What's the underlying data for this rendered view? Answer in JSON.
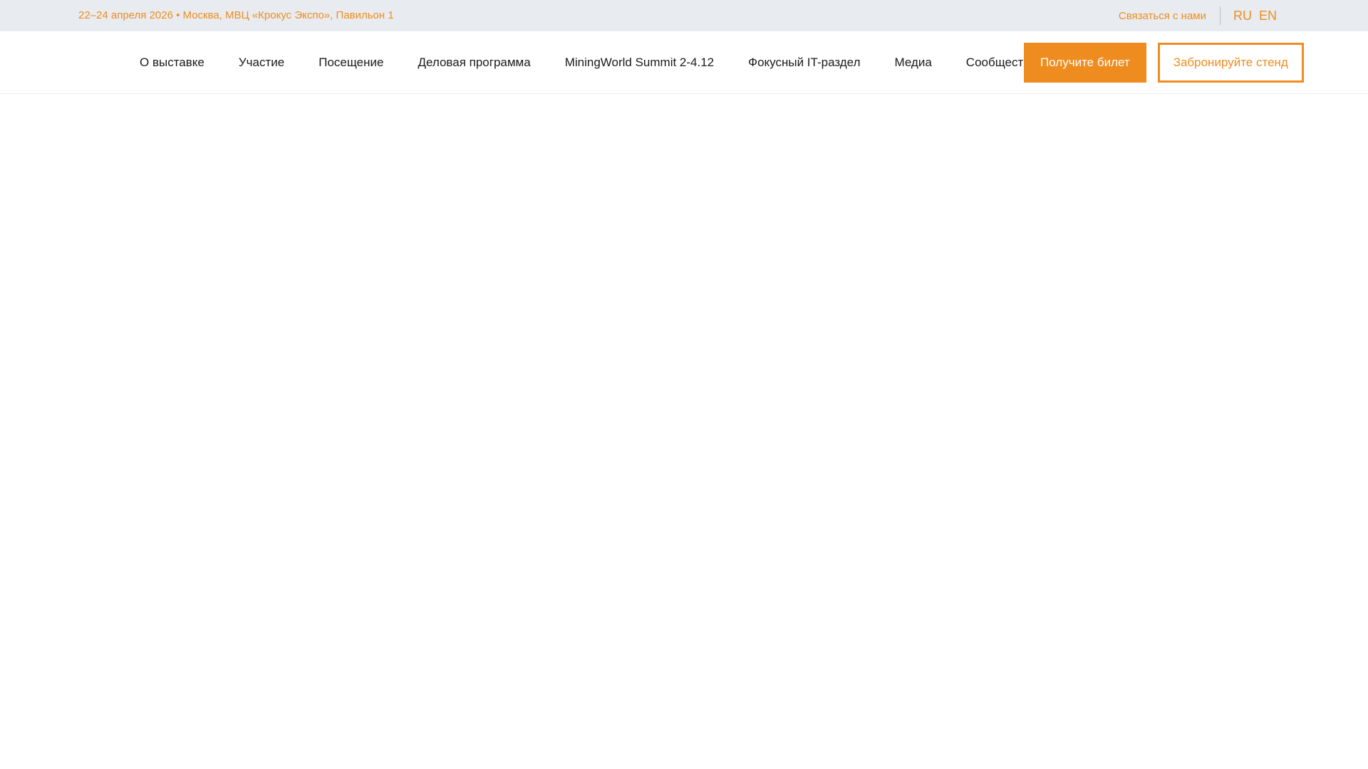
{
  "topbar": {
    "event_info": "22–24 апреля 2026 • Москва, МВЦ «Крокус Экспо», Павильон 1",
    "contact_label": "Связаться с нами",
    "languages": [
      "RU",
      "EN"
    ]
  },
  "nav": {
    "items": [
      "О выставке",
      "Участие",
      "Посещение",
      "Деловая программа",
      "MiningWorld Summit 2-4.12",
      "Фокусный IT-раздел",
      "Медиа",
      "Сообщество"
    ],
    "ticket_button": "Получите билет",
    "stand_button": "Забронируйте стенд"
  },
  "colors": {
    "accent": "#ef8c1f",
    "topbar_bg": "#e8ecf0",
    "text": "#1a1a1a"
  }
}
